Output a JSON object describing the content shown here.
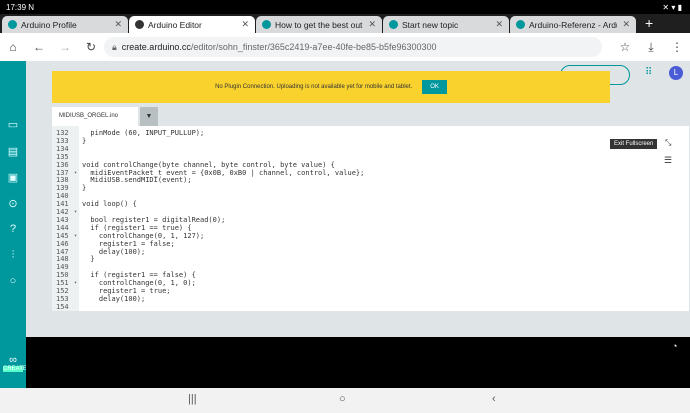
{
  "status": {
    "time": "17:39",
    "left_icons": "N",
    "right_icons": "✕ ▾ ▮"
  },
  "tabs": [
    {
      "label": "Arduino Profile"
    },
    {
      "label": "Arduino Editor",
      "active": true
    },
    {
      "label": "How to get the best out of"
    },
    {
      "label": "Start new topic"
    },
    {
      "label": "Arduino-Referenz - Arduin"
    }
  ],
  "address": {
    "domain": "create.arduino.cc",
    "path": "/editor/sohn_finster/365c2419-a7ee-40fe-be85-b5fe96300300"
  },
  "banner": {
    "message": "No Plugin Connection. Uploading is not available yet for mobile and tablet.",
    "ok_label": "OK",
    "color": "#f9d22e"
  },
  "user": {
    "initial": "L"
  },
  "file_tab": {
    "name": "MIDIUSB_ORGEL.ino"
  },
  "tooltip": "Exit Fullscreen",
  "logo": {
    "text": "CREATE"
  },
  "accent": "#00979d",
  "code": {
    "line_numbers": [
      "132",
      "133",
      "134",
      "135",
      "136",
      "137",
      "138",
      "139",
      "140",
      "141",
      "142",
      "143",
      "144",
      "145",
      "146",
      "147",
      "148",
      "149",
      "150",
      "151",
      "152",
      "153",
      "154"
    ],
    "lines": [
      "  pinMode (60, INPUT_PULLUP);",
      "}",
      "",
      "",
      "void controlChange(byte channel, byte control, byte value) {",
      "  midiEventPacket_t event = {0x0B, 0xB0 | channel, control, value};",
      "  MidiUSB.sendMIDI(event);",
      "}",
      "",
      "void loop() {",
      "",
      "  bool register1 = digitalRead(0);",
      "  if (register1 == true) {",
      "    controlChange(0, 1, 127);",
      "    register1 = false;",
      "    delay(100);",
      "  }",
      "",
      "  if (register1 == false) {",
      "    controlChange(0, 1, 0);",
      "    register1 = true;",
      "    delay(100);",
      ""
    ]
  }
}
